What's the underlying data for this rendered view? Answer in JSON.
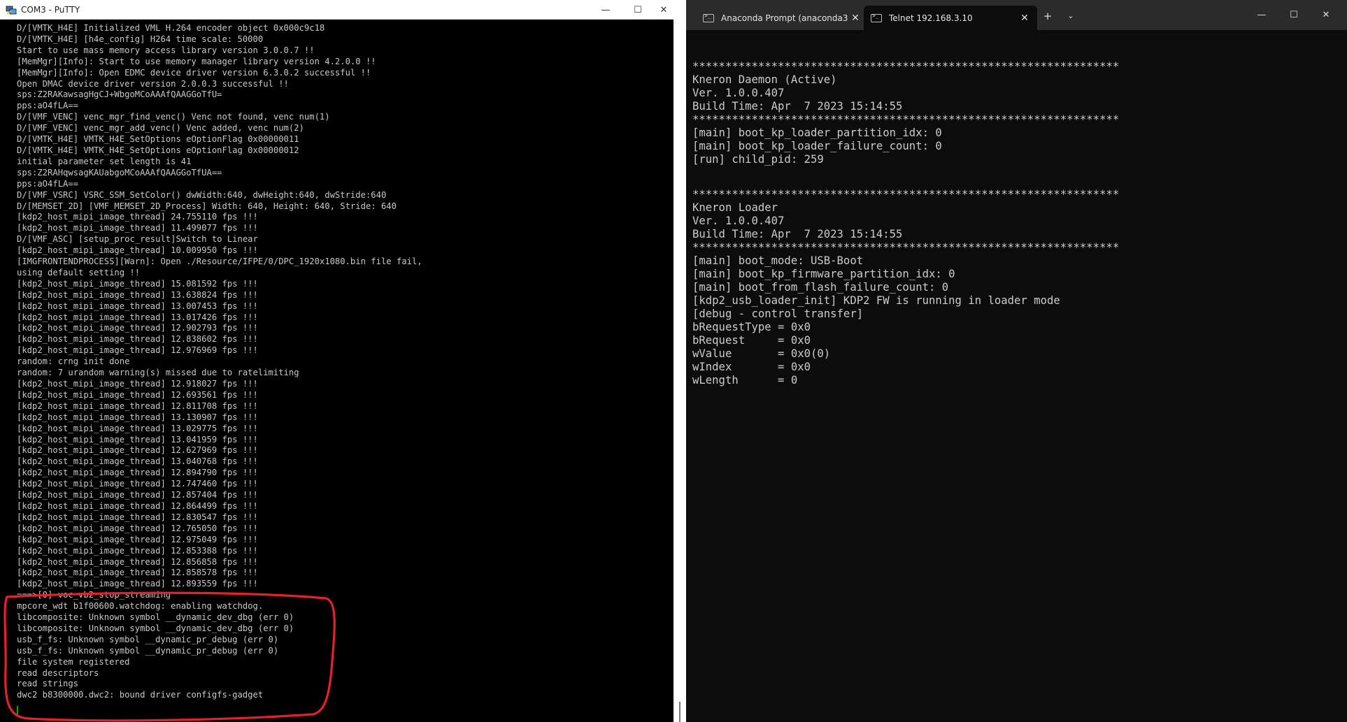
{
  "putty": {
    "title": "COM3 - PuTTY",
    "lines": [
      "D/[VMTK_H4E] Initialized VML H.264 encoder object 0x000c9c18",
      "D/[VMTK_H4E] [h4e_config] H264 time scale: 50000",
      "Start to use mass memory access library version 3.0.0.7 !!",
      "[MemMgr][Info]: Start to use memory manager library version 4.2.0.0 !!",
      "[MemMgr][Info]: Open EDMC device driver version 6.3.0.2 successful !!",
      "Open DMAC device driver version 2.0.0.3 successful !!",
      "sps:Z2RAKawsagHgCJ+WbgoMCoAAAfQAAGGoTfU=",
      "pps:aO4fLA==",
      "D/[VMF_VENC] venc_mgr_find_venc() Venc not found, venc num(1)",
      "D/[VMF_VENC] venc_mgr_add_venc() Venc added, venc num(2)",
      "D/[VMTK_H4E] VMTK_H4E_SetOptions eOptionFlag 0x00000011",
      "D/[VMTK_H4E] VMTK_H4E_SetOptions eOptionFlag 0x00000012",
      "initial parameter set length is 41",
      "sps:Z2RAHqwsagKAUabgoMCoAAAfQAAGGoTfUA==",
      "pps:aO4fLA==",
      "D/[VMF_VSRC] VSRC_SSM_SetColor() dwWidth:640, dwHeight:640, dwStride:640",
      "D/[MEMSET_2D] [VMF_MEMSET_2D_Process] Width: 640, Height: 640, Stride: 640",
      "[kdp2_host_mipi_image_thread] 24.755110 fps !!!",
      "[kdp2_host_mipi_image_thread] 11.499077 fps !!!",
      "D/[VMF_ASC] [setup_proc_result]Switch to Linear",
      "[kdp2_host_mipi_image_thread] 10.009950 fps !!!",
      "[IMGFRONTENDPROCESS][Warn]: Open ./Resource/IFPE/0/DPC_1920x1080.bin file fail,",
      "using default setting !!",
      "[kdp2_host_mipi_image_thread] 15.081592 fps !!!",
      "[kdp2_host_mipi_image_thread] 13.638824 fps !!!",
      "[kdp2_host_mipi_image_thread] 13.007453 fps !!!",
      "[kdp2_host_mipi_image_thread] 13.017426 fps !!!",
      "[kdp2_host_mipi_image_thread] 12.902793 fps !!!",
      "[kdp2_host_mipi_image_thread] 12.838602 fps !!!",
      "[kdp2_host_mipi_image_thread] 12.976969 fps !!!",
      "random: crng init done",
      "random: 7 urandom warning(s) missed due to ratelimiting",
      "[kdp2_host_mipi_image_thread] 12.918027 fps !!!",
      "[kdp2_host_mipi_image_thread] 12.693561 fps !!!",
      "[kdp2_host_mipi_image_thread] 12.811708 fps !!!",
      "[kdp2_host_mipi_image_thread] 13.130907 fps !!!",
      "[kdp2_host_mipi_image_thread] 13.029775 fps !!!",
      "[kdp2_host_mipi_image_thread] 13.041959 fps !!!",
      "[kdp2_host_mipi_image_thread] 12.627969 fps !!!",
      "[kdp2_host_mipi_image_thread] 13.040768 fps !!!",
      "[kdp2_host_mipi_image_thread] 12.894790 fps !!!",
      "[kdp2_host_mipi_image_thread] 12.747460 fps !!!",
      "[kdp2_host_mipi_image_thread] 12.857404 fps !!!",
      "[kdp2_host_mipi_image_thread] 12.864499 fps !!!",
      "[kdp2_host_mipi_image_thread] 12.830547 fps !!!",
      "[kdp2_host_mipi_image_thread] 12.765050 fps !!!",
      "[kdp2_host_mipi_image_thread] 12.975049 fps !!!",
      "[kdp2_host_mipi_image_thread] 12.853388 fps !!!",
      "[kdp2_host_mipi_image_thread] 12.856858 fps !!!",
      "[kdp2_host_mipi_image_thread] 12.858578 fps !!!",
      "[kdp2_host_mipi_image_thread] 12.893559 fps !!!",
      "===>[0] voc_vb2_stop_streaming",
      "mpcore_wdt b1f00600.watchdog: enabling watchdog.",
      "libcomposite: Unknown symbol __dynamic_dev_dbg (err 0)",
      "libcomposite: Unknown symbol __dynamic_dev_dbg (err 0)",
      "usb_f_fs: Unknown symbol __dynamic_pr_debug (err 0)",
      "usb_f_fs: Unknown symbol __dynamic_pr_debug (err 0)",
      "file system registered",
      "read descriptors",
      "read strings",
      "dwc2 b8300000.dwc2: bound driver configfs-gadget"
    ]
  },
  "terminal": {
    "tabs": [
      {
        "label": "Anaconda Prompt (anaconda3",
        "active": false
      },
      {
        "label": "Telnet 192.168.3.10",
        "active": true
      }
    ],
    "lines": [
      "*****************************************************************",
      "Kneron Daemon (Active)",
      "Ver. 1.0.0.407",
      "Build Time: Apr  7 2023 15:14:55",
      "*****************************************************************",
      "[main] boot_kp_loader_partition_idx: 0",
      "[main] boot_kp_loader_failure_count: 0",
      "[run] child_pid: 259",
      "",
      "",
      "*****************************************************************",
      "Kneron Loader",
      "Ver. 1.0.0.407",
      "Build Time: Apr  7 2023 15:14:55",
      "*****************************************************************",
      "[main] boot_mode: USB-Boot",
      "[main] boot_kp_firmware_partition_idx: 0",
      "[main] boot_from_flash_failure_count: 0",
      "[kdp2_usb_loader_init] KDP2 FW is running in loader mode",
      "[debug - control transfer]",
      "bRequestType = 0x0",
      "bRequest     = 0x0",
      "wValue       = 0x0(0)",
      "wIndex       = 0x0",
      "wLength      = 0"
    ]
  },
  "colors": {
    "putty_bg": "#000000",
    "putty_text": "#c8c8c8",
    "terminal_bg": "#0c0c0c",
    "terminal_text": "#cccccc",
    "annotation": "#e8202a"
  },
  "icons": {
    "putty_app": "putty-app-icon",
    "terminal_tab": "terminal-tab-icon",
    "close": "close-icon",
    "new_tab": "plus-icon",
    "dropdown": "chevron-down-icon"
  }
}
